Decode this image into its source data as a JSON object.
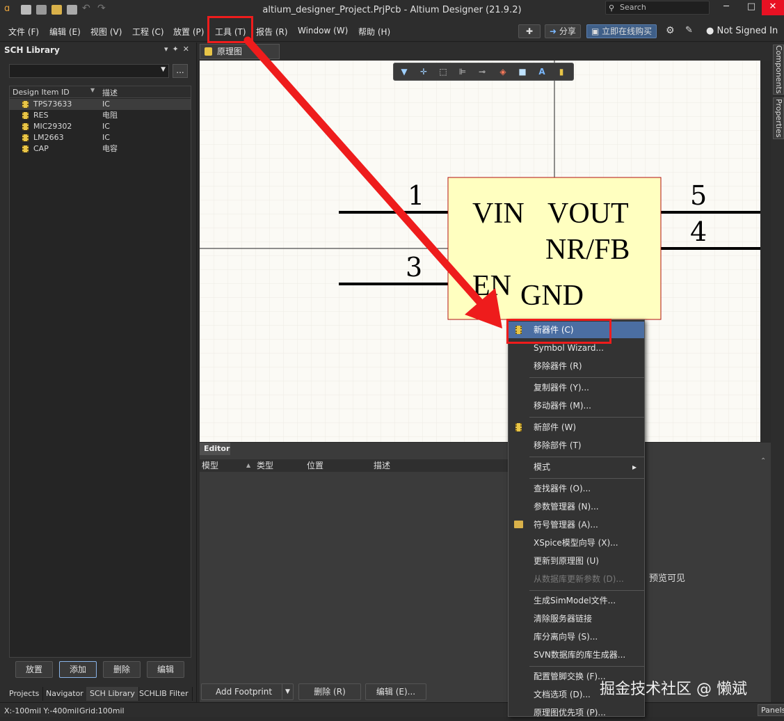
{
  "window": {
    "title": "altium_designer_Project.PrjPcb - Altium Designer (21.9.2)",
    "search_placeholder": "Search",
    "minimize": "─",
    "maximize": "□",
    "close": "✕"
  },
  "menu": [
    "文件 (F)",
    "编辑 (E)",
    "视图 (V)",
    "工程 (C)",
    "放置 (P)",
    "工具 (T)",
    "报告 (R)",
    "Window (W)",
    "帮助 (H)"
  ],
  "toolbar_right": {
    "share": "分享",
    "buy": "立即在线购买",
    "user": "Not Signed In"
  },
  "sch_library": {
    "title": "SCH Library",
    "dots": "...",
    "columns": [
      "Design Item ID",
      "描述"
    ],
    "items": [
      {
        "id": "TPS73633",
        "desc": "IC"
      },
      {
        "id": "RES",
        "desc": "电阻"
      },
      {
        "id": "MIC29302",
        "desc": "IC"
      },
      {
        "id": "LM2663",
        "desc": "IC"
      },
      {
        "id": "CAP",
        "desc": "电容"
      }
    ],
    "buttons": [
      "放置",
      "添加",
      "删除",
      "编辑"
    ],
    "tabs": [
      "Projects",
      "Navigator",
      "SCH Library",
      "SCHLIB Filter"
    ]
  },
  "document": {
    "tab_label": "原理图库.SchLib"
  },
  "symbol": {
    "pins": {
      "p1": "1",
      "p3": "3",
      "p5": "5",
      "p4": "4"
    },
    "labels": {
      "vin": "VIN",
      "vout": "VOUT",
      "nrfb": "NR/FB",
      "en": "EN",
      "gnd": "GND"
    }
  },
  "editor": {
    "tab": "Editor",
    "columns": [
      "模型",
      "类型",
      "位置",
      "描述"
    ],
    "preview_text": "预览可见",
    "add_footprint": "Add Footprint",
    "delete": "删除 (R)",
    "edit": "编辑 (E)..."
  },
  "context_menu": {
    "items": [
      {
        "label": "新器件 (C)"
      },
      {
        "label": "Symbol Wizard..."
      },
      {
        "label": "移除器件 (R)"
      },
      {
        "label": "复制器件 (Y)..."
      },
      {
        "label": "移动器件 (M)..."
      },
      {
        "label": "新部件 (W)"
      },
      {
        "label": "移除部件 (T)"
      },
      {
        "label": "模式"
      },
      {
        "label": "查找器件 (O)..."
      },
      {
        "label": "参数管理器 (N)..."
      },
      {
        "label": "符号管理器 (A)..."
      },
      {
        "label": "XSpice模型向导 (X)..."
      },
      {
        "label": "更新到原理图 (U)"
      },
      {
        "label": "从数据库更新参数 (D)..."
      },
      {
        "label": "生成SimModel文件..."
      },
      {
        "label": "清除服务器链接"
      },
      {
        "label": "库分离向导 (S)..."
      },
      {
        "label": "SVN数据库的库生成器..."
      },
      {
        "label": "配置管脚交换 (F)..."
      },
      {
        "label": "文档选项 (D)..."
      },
      {
        "label": "原理图优先项 (P)..."
      }
    ],
    "submenu_arrow": "▸"
  },
  "right_tabs": [
    "Components",
    "Properties"
  ],
  "status": {
    "coords": "X:-100mil Y:-400mil",
    "grid": "Grid:100mil",
    "panels": "Panels"
  },
  "watermark": "掘金技术社区 @ 懒斌",
  "colors": {
    "accent": "#4b6ea2",
    "annotation_red": "#ee1c1c",
    "component_fill": "#ffffc0",
    "component_border": "#b01010"
  }
}
